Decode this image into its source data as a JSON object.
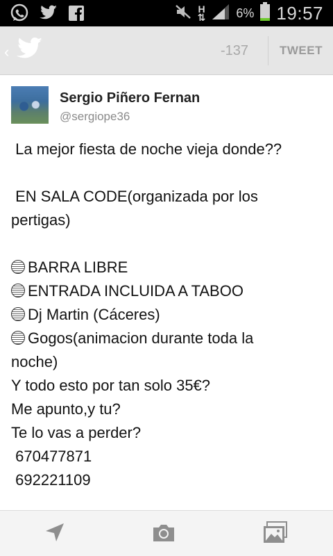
{
  "status_bar": {
    "left_icons": [
      "whatsapp-icon",
      "twitter-icon",
      "facebook-icon"
    ],
    "network_type": "H",
    "battery_percent": "6%",
    "time": "19:57"
  },
  "action_bar": {
    "char_counter": "-137",
    "tweet_label": "TWEET"
  },
  "tweet": {
    "author_name": "Sergio Piñero Fernan",
    "author_handle": "@sergiope36",
    "lines": [
      " La mejor fiesta de noche vieja donde??",
      "",
      " EN SALA CODE(organizada por los",
      "pertigas)",
      "",
      "BARRA LIBRE",
      "ENTRADA INCLUIDA A TABOO",
      "Dj Martin (Cáceres)",
      "Gogos(animacion durante toda la",
      "noche)",
      "Y todo esto por tan solo 35€?",
      "Me apunto,y tu?",
      "Te lo vas a perder?",
      " 670477871",
      " 692221109"
    ]
  },
  "bottom_bar": {
    "icons": [
      "location-icon",
      "camera-icon",
      "gallery-icon"
    ]
  },
  "colors": {
    "status_bar_bg": "#000000",
    "action_bar_bg": "#e6e6e6",
    "accent_bird": "#ffffff",
    "battery_low": "#6ec92e"
  }
}
